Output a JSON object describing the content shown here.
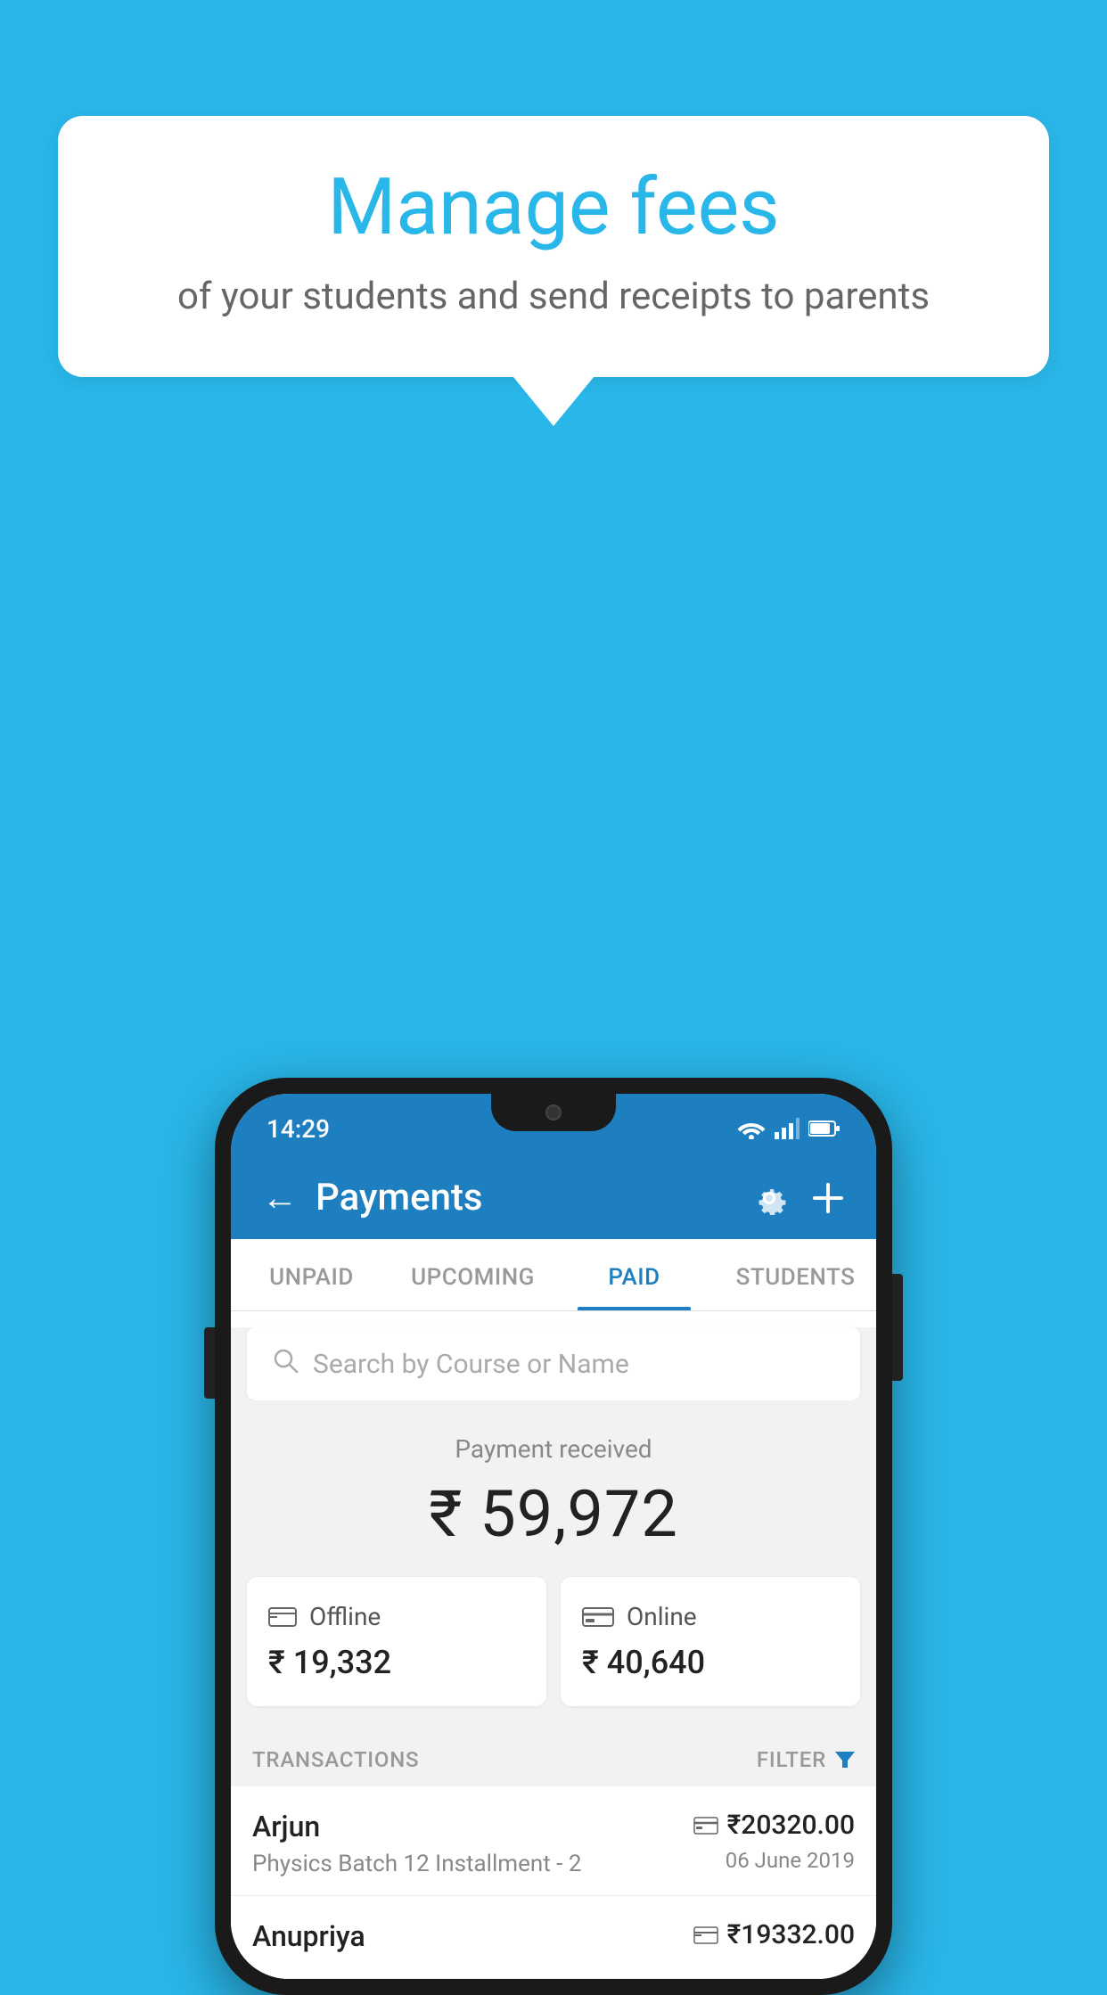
{
  "background_color": "#29b6e8",
  "speech_bubble": {
    "title": "Manage fees",
    "subtitle": "of your students and send receipts to parents"
  },
  "status_bar": {
    "time": "14:29",
    "icons": [
      "wifi",
      "signal",
      "battery"
    ]
  },
  "header": {
    "title": "Payments",
    "back_label": "←",
    "settings_icon": "gear",
    "add_icon": "+"
  },
  "tabs": [
    {
      "label": "UNPAID",
      "active": false
    },
    {
      "label": "UPCOMING",
      "active": false
    },
    {
      "label": "PAID",
      "active": true
    },
    {
      "label": "STUDENTS",
      "active": false
    }
  ],
  "search": {
    "placeholder": "Search by Course or Name"
  },
  "payment_summary": {
    "label": "Payment received",
    "amount": "₹ 59,972",
    "offline": {
      "label": "Offline",
      "amount": "₹ 19,332"
    },
    "online": {
      "label": "Online",
      "amount": "₹ 40,640"
    }
  },
  "transactions": {
    "section_label": "TRANSACTIONS",
    "filter_label": "FILTER",
    "rows": [
      {
        "name": "Arjun",
        "detail": "Physics Batch 12 Installment - 2",
        "payment_type": "online",
        "amount": "₹20320.00",
        "date": "06 June 2019"
      },
      {
        "name": "Anupriya",
        "detail": "",
        "payment_type": "offline",
        "amount": "₹19332.00",
        "date": ""
      }
    ]
  }
}
